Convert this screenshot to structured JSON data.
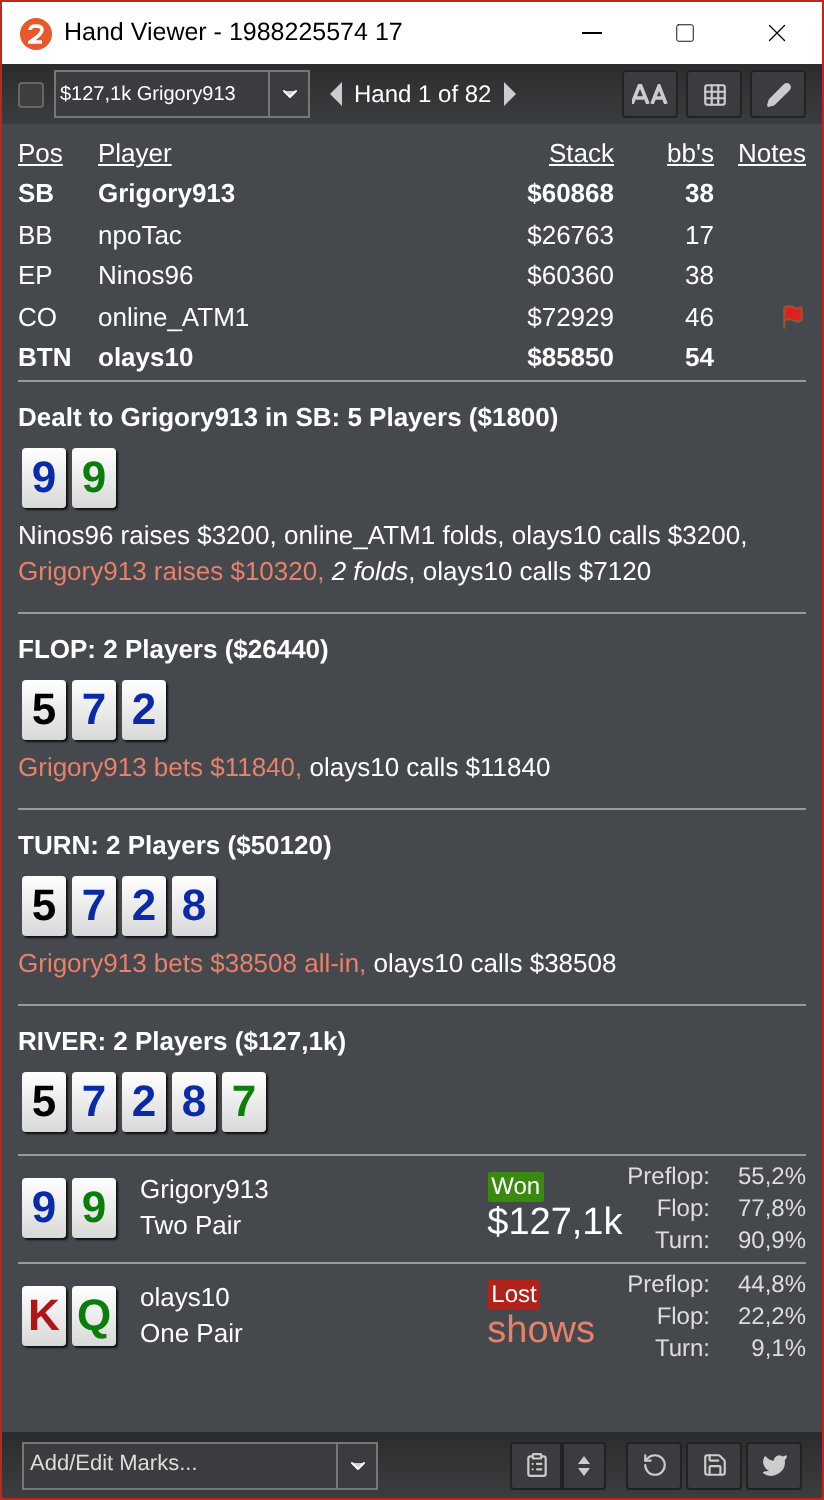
{
  "window": {
    "title": "Hand Viewer - 1988225574 17"
  },
  "toolbar": {
    "checked": false,
    "hand_select": "$127,1k Grigory913",
    "nav": "Hand 1 of 82"
  },
  "players": {
    "columns": [
      "Pos",
      "Player",
      "Stack",
      "bb's",
      "Notes"
    ],
    "rows": [
      {
        "pos": "SB",
        "player": "Grigory913",
        "stack": "$60868",
        "bbs": "38",
        "hero": true,
        "flag": false
      },
      {
        "pos": "BB",
        "player": "npoTac",
        "stack": "$26763",
        "bbs": "17",
        "hero": false,
        "flag": false
      },
      {
        "pos": "EP",
        "player": "Ninos96",
        "stack": "$60360",
        "bbs": "38",
        "hero": false,
        "flag": false
      },
      {
        "pos": "CO",
        "player": "online_ATM1",
        "stack": "$72929",
        "bbs": "46",
        "hero": false,
        "flag": true
      },
      {
        "pos": "BTN",
        "player": "olays10",
        "stack": "$85850",
        "bbs": "54",
        "hero": true,
        "flag": false
      }
    ]
  },
  "streets": [
    {
      "heading": "Dealt to Grigory913 in SB: 5 Players ($1800)",
      "cards": [
        {
          "rank": "9",
          "color": "#0a2aa8"
        },
        {
          "rank": "9",
          "color": "#0b7d0b"
        }
      ],
      "actions": [
        [
          {
            "kind": "plain",
            "text": "Ninos96 raises $3200, online_ATM1 folds, olays10 calls $3200,"
          }
        ],
        [
          {
            "kind": "hero",
            "text": "Grigory913 raises $10320,"
          },
          {
            "kind": "italic",
            "text": "2 folds"
          },
          {
            "kind": "plain",
            "text": ", olays10 calls $7120"
          }
        ]
      ]
    },
    {
      "heading": "FLOP: 2 Players ($26440)",
      "cards": [
        {
          "rank": "5",
          "color": "#000000"
        },
        {
          "rank": "7",
          "color": "#0a2aa8"
        },
        {
          "rank": "2",
          "color": "#0a2aa8"
        }
      ],
      "actions": [
        [
          {
            "kind": "hero",
            "text": "Grigory913 bets $11840,"
          },
          {
            "kind": "plain",
            "text": "olays10 calls $11840"
          }
        ]
      ]
    },
    {
      "heading": "TURN: 2 Players ($50120)",
      "cards": [
        {
          "rank": "5",
          "color": "#000000"
        },
        {
          "rank": "7",
          "color": "#0a2aa8"
        },
        {
          "rank": "2",
          "color": "#0a2aa8"
        },
        {
          "rank": "8",
          "color": "#0a2aa8"
        }
      ],
      "actions": [
        [
          {
            "kind": "hero",
            "text": "Grigory913 bets $38508 all-in,"
          },
          {
            "kind": "plain",
            "text": "olays10 calls $38508"
          }
        ]
      ]
    },
    {
      "heading": "RIVER: 2 Players ($127,1k)",
      "cards": [
        {
          "rank": "5",
          "color": "#000000"
        },
        {
          "rank": "7",
          "color": "#0a2aa8"
        },
        {
          "rank": "2",
          "color": "#0a2aa8"
        },
        {
          "rank": "8",
          "color": "#0a2aa8"
        },
        {
          "rank": "7",
          "color": "#0b7d0b"
        }
      ]
    }
  ],
  "showdown": [
    {
      "name": "Grigory913",
      "hand": "Two Pair",
      "won": true,
      "badge": "Won",
      "amount": "$127,1k",
      "cards": [
        {
          "rank": "9",
          "color": "#0a2aa8"
        },
        {
          "rank": "9",
          "color": "#0b7d0b"
        }
      ],
      "equity": [
        {
          "label": "Preflop:",
          "value": "55,2%"
        },
        {
          "label": "Flop:",
          "value": "77,8%"
        },
        {
          "label": "Turn:",
          "value": "90,9%"
        }
      ]
    },
    {
      "name": "olays10",
      "hand": "One Pair",
      "won": false,
      "badge": "Lost",
      "amount": "shows",
      "cards": [
        {
          "rank": "K",
          "color": "#b01515"
        },
        {
          "rank": "Q",
          "color": "#0b7d0b"
        }
      ],
      "equity": [
        {
          "label": "Preflop:",
          "value": "44,8%"
        },
        {
          "label": "Flop:",
          "value": "22,2%"
        },
        {
          "label": "Turn:",
          "value": "9,1%"
        }
      ]
    }
  ],
  "bottom": {
    "marks_placeholder": "Add/Edit Marks..."
  }
}
